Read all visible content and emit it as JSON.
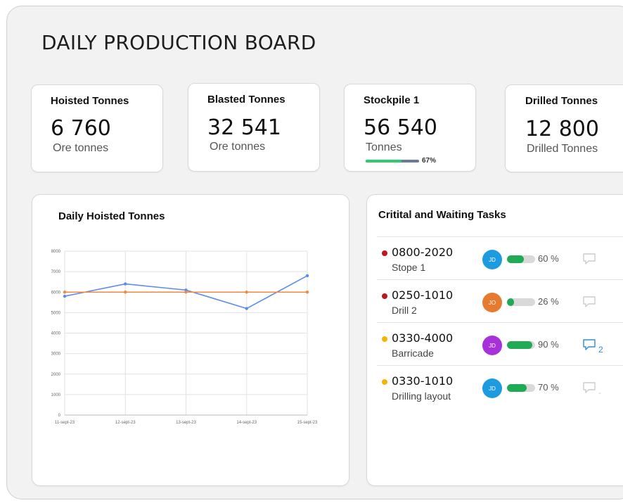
{
  "board": {
    "title": "DAILY PRODUCTION BOARD"
  },
  "kpis": [
    {
      "label": "Hoisted Tonnes",
      "value": "6 760",
      "unit": "Ore tonnes"
    },
    {
      "label": "Blasted Tonnes",
      "value": "32 541",
      "unit": "Ore tonnes"
    },
    {
      "label": "Stockpile 1",
      "value": "56 540",
      "unit": "Tonnes",
      "progress_pct": 67,
      "progress_label": "67%"
    },
    {
      "label": "Drilled Tonnes",
      "value": "12 800",
      "unit": "Drilled Tonnes"
    }
  ],
  "chart_data": {
    "type": "line",
    "title": "Daily Hoisted Tonnes",
    "categories": [
      "11-sept-23",
      "12-sept-23",
      "13-sept-23",
      "14-sept-23",
      "15-sept-23"
    ],
    "series": [
      {
        "values": [
          5800,
          6400,
          6100,
          5200,
          6800
        ],
        "color": "#5b8def"
      },
      {
        "values": [
          6000,
          6000,
          6000,
          6000,
          6000
        ],
        "color": "#f0883e"
      }
    ],
    "ylim": [
      0,
      8000
    ],
    "yticks": [
      0,
      1000,
      2000,
      3000,
      4000,
      5000,
      6000,
      7000,
      8000
    ],
    "grid": true
  },
  "tasks": {
    "title": "Critital and Waiting Tasks",
    "items": [
      {
        "id": "0800-2020",
        "name": "Stope 1",
        "status_color": "#c0151b",
        "avatar": "JD",
        "avatar_color": "#1d9be0",
        "progress_pct": 60,
        "progress_label": "60 %",
        "comment_count": "",
        "comment_color": "#cccccc"
      },
      {
        "id": "0250-1010",
        "name": "Drill 2",
        "status_color": "#c0151b",
        "avatar": "JO",
        "avatar_color": "#e67a2e",
        "progress_pct": 26,
        "progress_label": "26 %",
        "comment_count": "",
        "comment_color": "#cccccc"
      },
      {
        "id": "0330-4000",
        "name": "Barricade",
        "status_color": "#f5b400",
        "avatar": "JD",
        "avatar_color": "#a832d9",
        "progress_pct": 90,
        "progress_label": "90 %",
        "comment_count": "2",
        "comment_color": "#2a8fd9"
      },
      {
        "id": "0330-1010",
        "name": "Drilling layout",
        "status_color": "#f5b400",
        "avatar": "JD",
        "avatar_color": "#1d9be0",
        "progress_pct": 70,
        "progress_label": "70 %",
        "comment_count": "-",
        "comment_color": "#cccccc"
      }
    ]
  }
}
